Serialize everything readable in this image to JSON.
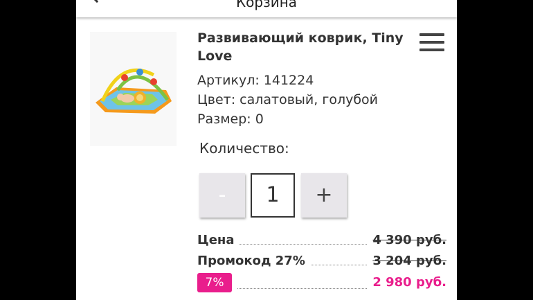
{
  "header": {
    "title": "Корзина",
    "back_icon": "arrow-left-icon"
  },
  "product": {
    "name": "Развивающий коврик, Tiny Love",
    "article": "Артикул: 141224",
    "color": "Цвет: салатовый, голубой",
    "size": "Размер: 0",
    "image": "baby-play-mat-image"
  },
  "menu_icon": "hamburger-menu-icon",
  "quantity": {
    "label": "Количество:",
    "minus_label": "-",
    "value": "1",
    "plus_label": "+"
  },
  "pricing": {
    "price_label": "Цена",
    "price_value": "4 390 руб.",
    "promo_label": "Промокод 27%",
    "promo_value": "3 204 руб.",
    "discount_badge": "7%",
    "final_value": "2 980 руб."
  },
  "colors": {
    "accent": "#e91e8c",
    "button_bg": "#e8e6ea",
    "backdrop": "#000000"
  }
}
